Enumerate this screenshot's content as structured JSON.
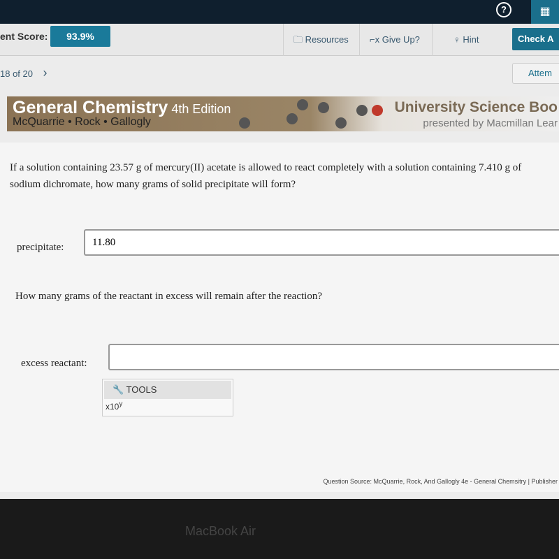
{
  "header": {
    "help_icon": "question-circle-icon",
    "calendar_icon": "calendar-icon"
  },
  "toolbar": {
    "score_label": "ent Score:",
    "score_value": "93.9%",
    "resources": "Resources",
    "give_up": "Give Up?",
    "hint": "Hint",
    "check": "Check A"
  },
  "nav": {
    "position": "18 of 20",
    "next": "›",
    "attempts": "Attem"
  },
  "banner": {
    "title": "General Chemistry",
    "edition": "4th Edition",
    "authors": "McQuarrie • Rock • Gallogly",
    "publisher": "University Science Boo",
    "presented": "presented by Macmillan Lear"
  },
  "question": {
    "text": "If a solution containing 23.57 g of mercury(II) acetate is allowed to react completely with a solution containing 7.410 g of sodium dichromate, how many grams of solid precipitate will form?",
    "precipitate_label": "precipitate:",
    "precipitate_value": "11.80",
    "text2": "How many grams of the reactant in excess will remain after the reaction?",
    "excess_label": "excess reactant:",
    "excess_value": ""
  },
  "tools": {
    "label": "TOOLS",
    "x10": "x10",
    "sup": "y"
  },
  "footer": {
    "source": "Question Source: McQuarrie, Rock, And Gallogly 4e - General Chemsitry  |  Publisher"
  },
  "device": "MacBook Air"
}
